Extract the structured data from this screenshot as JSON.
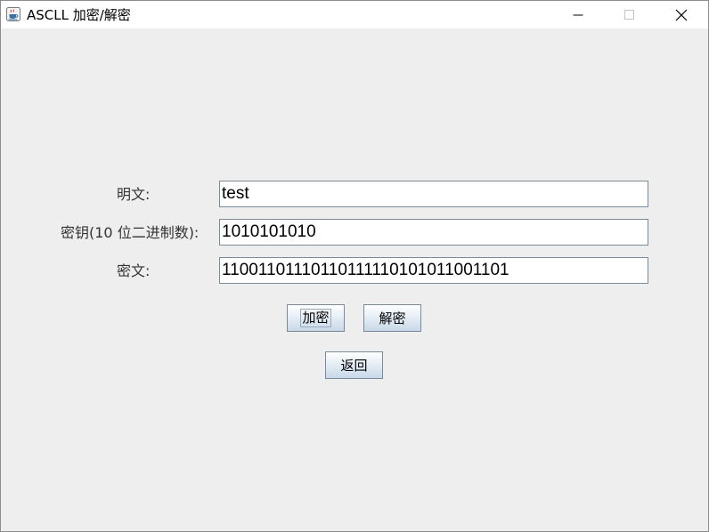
{
  "window": {
    "title": "ASCLL 加密/解密"
  },
  "icons": {
    "app": "java-coffee-cup-icon",
    "minimize": "minimize-icon",
    "maximize": "maximize-icon",
    "close": "close-icon"
  },
  "form": {
    "plaintext_label": "明文:",
    "plaintext_value": "test",
    "key_label": "密钥(10 位二进制数):",
    "key_value": "1010101010",
    "ciphertext_label": "密文:",
    "ciphertext_value": "11001101110110111110101011001101"
  },
  "buttons": {
    "encrypt": "加密",
    "decrypt": "解密",
    "back": "返回"
  },
  "colors": {
    "window_bg": "#eeeeee",
    "button_gradient_top": "#ffffff",
    "button_gradient_bottom": "#c8d8e8",
    "field_border": "#7a8a99"
  }
}
